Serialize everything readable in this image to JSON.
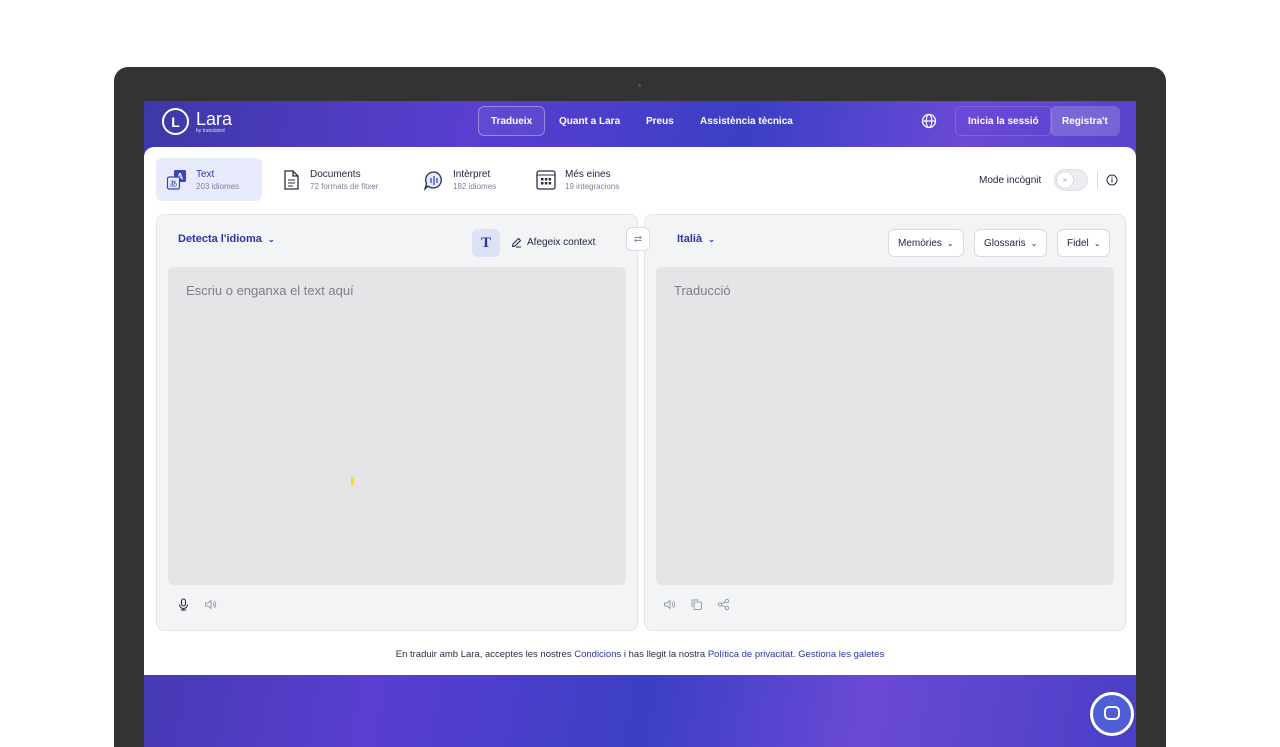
{
  "nav": {
    "logo_name": "Lara",
    "logo_sub": "by translated",
    "logo_letter": "L",
    "links": [
      "Tradueix",
      "Quant a Lara",
      "Preus",
      "Assistència tècnica"
    ],
    "login": "Inicia la sessió",
    "register": "Registra't"
  },
  "modes": [
    {
      "title": "Text",
      "sub": "203 idiomes",
      "icon": "text-translate-icon"
    },
    {
      "title": "Documents",
      "sub": "72 formats de fitxer",
      "icon": "document-icon"
    },
    {
      "title": "Intèrpret",
      "sub": "182 idiomes",
      "icon": "interpreter-icon"
    },
    {
      "title": "Més eines",
      "sub": "19 integracions",
      "icon": "grid-tools-icon"
    }
  ],
  "incognito": {
    "label": "Mode incògnit",
    "toggle_symbol": "×",
    "enabled": false
  },
  "source": {
    "language": "Detecta l'idioma",
    "context_button": "Afegeix context",
    "format_button": "T",
    "placeholder": "Escriu o enganxa el text aquí"
  },
  "swap_symbol": "⇄",
  "target": {
    "language": "Italià",
    "memories": "Memòries",
    "glossaries": "Glossaris",
    "style": "Fidel",
    "placeholder": "Traducció"
  },
  "footer": {
    "text1": "En traduir amb Lara, acceptes les nostres",
    "terms": "Condicions",
    "text2": "i has llegit la nostra",
    "privacy": "Política de privacitat.",
    "cookies": "Gestiona les galetes"
  },
  "colors": {
    "accent": "#2c36a8",
    "brand_gradient": "#5a3ed0"
  }
}
